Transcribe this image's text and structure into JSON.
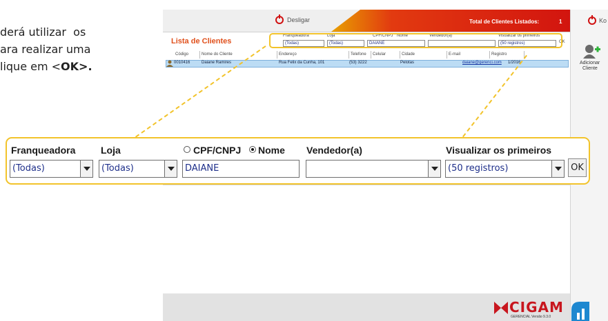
{
  "instruction": {
    "line1": "derá utilizar  os",
    "line2": "ara realizar uma",
    "line3_pre": "lique em <",
    "line3_ok": "OK",
    "line3_post": ">."
  },
  "app": {
    "logout_label": "Desligar",
    "total_label": "Total de Clientes Listados:",
    "total_value": "1",
    "right_top_label": "Ko",
    "list_title": "Lista de Clientes",
    "add_client_label1": "Adicionar",
    "add_client_label2": "Cliente",
    "brand": "CIGAM",
    "brand_sub": "GERENCIAL  Versão 9.3.0"
  },
  "mini_filters": {
    "franqueadora_label": "Franqueadora",
    "loja_label": "Loja",
    "cpf_label": "CPF/CNPJ",
    "nome_label": "Nome",
    "vendedor_label": "Vendedor(a)",
    "visualizar_label": "Visualizar os primeiros",
    "franqueadora_value": "(Todas)",
    "loja_value": "(Todas)",
    "search_value": "DAIANE",
    "visualizar_value": "(50 registros)",
    "ok_label": "OK"
  },
  "table": {
    "headers": [
      "Código",
      "Nome do Cliente",
      "Endereço",
      "Telefone",
      "Celular",
      "Cidade",
      "E-mail",
      "Registro"
    ],
    "row": [
      "0010416",
      "Daiane Ramires",
      "Rua Felix da Cunha, 101",
      "(53) 3222",
      "",
      "Pelotas",
      "daiane@gerenci.com",
      "1/2016"
    ]
  },
  "callout": {
    "franqueadora_label": "Franqueadora",
    "loja_label": "Loja",
    "cpf_label": "CPF/CNPJ",
    "nome_label": "Nome",
    "vendedor_label": "Vendedor(a)",
    "visualizar_label": "Visualizar os primeiros",
    "franqueadora_value": "(Todas)",
    "loja_value": "(Todas)",
    "search_value": "DAIANE",
    "vendedor_value": "",
    "visualizar_value": "(50 registros)",
    "ok_label": "OK"
  },
  "colors": {
    "accent_yellow": "#f2c32a",
    "brand_red": "#c8161e",
    "title_orange": "#e0501c",
    "selected_row": "#bcdcf4"
  }
}
